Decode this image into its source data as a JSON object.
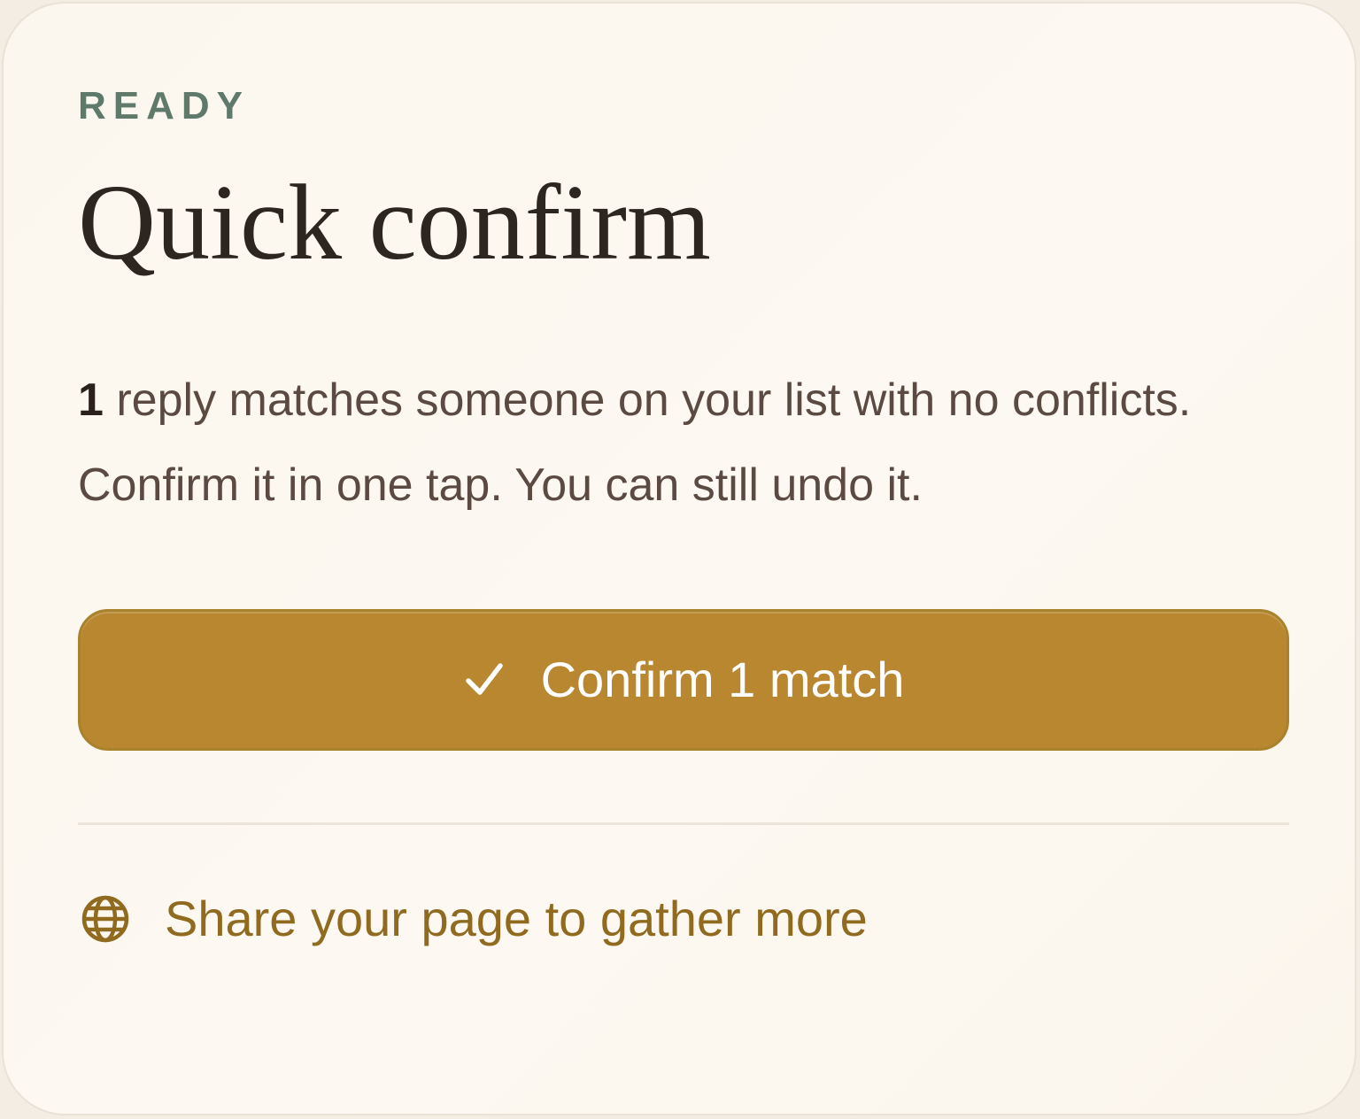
{
  "card": {
    "eyebrow": "READY",
    "title": "Quick confirm",
    "description": {
      "count": "1",
      "text": " reply matches someone on your list with no conflicts. Confirm it in one tap. You can still undo it."
    },
    "confirm_button": {
      "icon": "check-icon",
      "label": "Confirm 1 match"
    },
    "share_link": {
      "icon": "globe-icon",
      "label": "Share your page to gather more"
    }
  },
  "colors": {
    "accent": "#b8872f",
    "link": "#8f6a1f",
    "eyebrow": "#5f7a6a",
    "title": "#2d2520",
    "body_text": "#5b4a42",
    "card_background": "#fcf8f0"
  }
}
